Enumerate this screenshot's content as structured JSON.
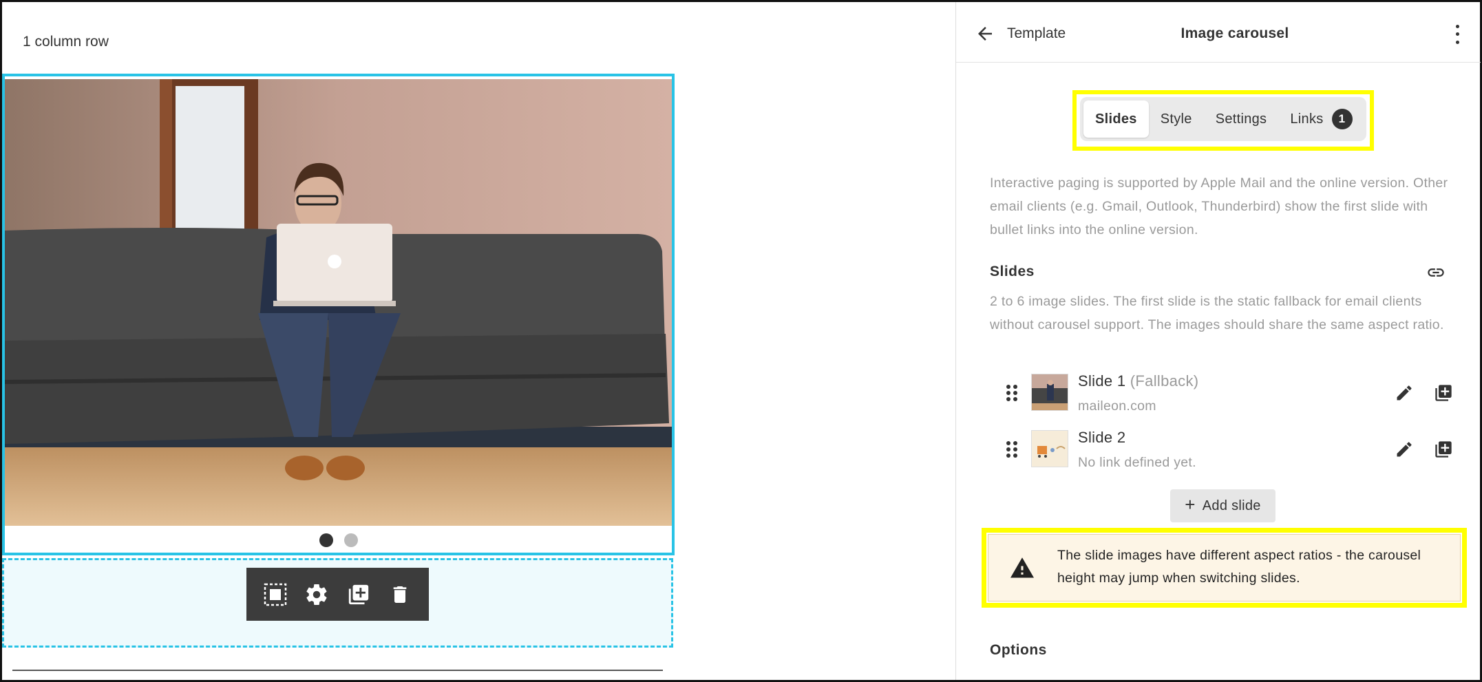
{
  "canvas": {
    "row_label": "1 column row",
    "carousel": {
      "active_slide_index": 0,
      "slide_count": 2
    },
    "toolbar": {
      "select_label": "select-parent-icon",
      "settings_label": "gear-icon",
      "duplicate_label": "duplicate-icon",
      "delete_label": "trash-icon"
    }
  },
  "panel": {
    "back_label": "Template",
    "title": "Image carousel",
    "tabs": [
      {
        "label": "Slides",
        "active": true
      },
      {
        "label": "Style",
        "active": false
      },
      {
        "label": "Settings",
        "active": false
      },
      {
        "label": "Links",
        "active": false,
        "badge": "1"
      }
    ],
    "info_text": "Interactive paging is supported by Apple Mail and the online version. Other email clients (e.g. Gmail, Outlook, Thunderbird) show the first slide with bullet links into the online version.",
    "slides_section": {
      "title": "Slides",
      "description": "2 to 6 image slides. The first slide is the static fallback for email clients without carousel support. The images should share the same aspect ratio.",
      "items": [
        {
          "name": "Slide 1",
          "suffix": "(Fallback)",
          "link": "maileon.com"
        },
        {
          "name": "Slide 2",
          "suffix": "",
          "link": "No link defined yet."
        }
      ],
      "add_label": "Add slide"
    },
    "warning": "The slide images have different aspect ratios - the carousel height may jump when switching slides.",
    "options_title": "Options"
  },
  "colors": {
    "accent": "#29c3e6",
    "highlight": "#ffff00",
    "warning_bg": "#fdf5e6",
    "toolbar_bg": "#3c3c3c"
  }
}
